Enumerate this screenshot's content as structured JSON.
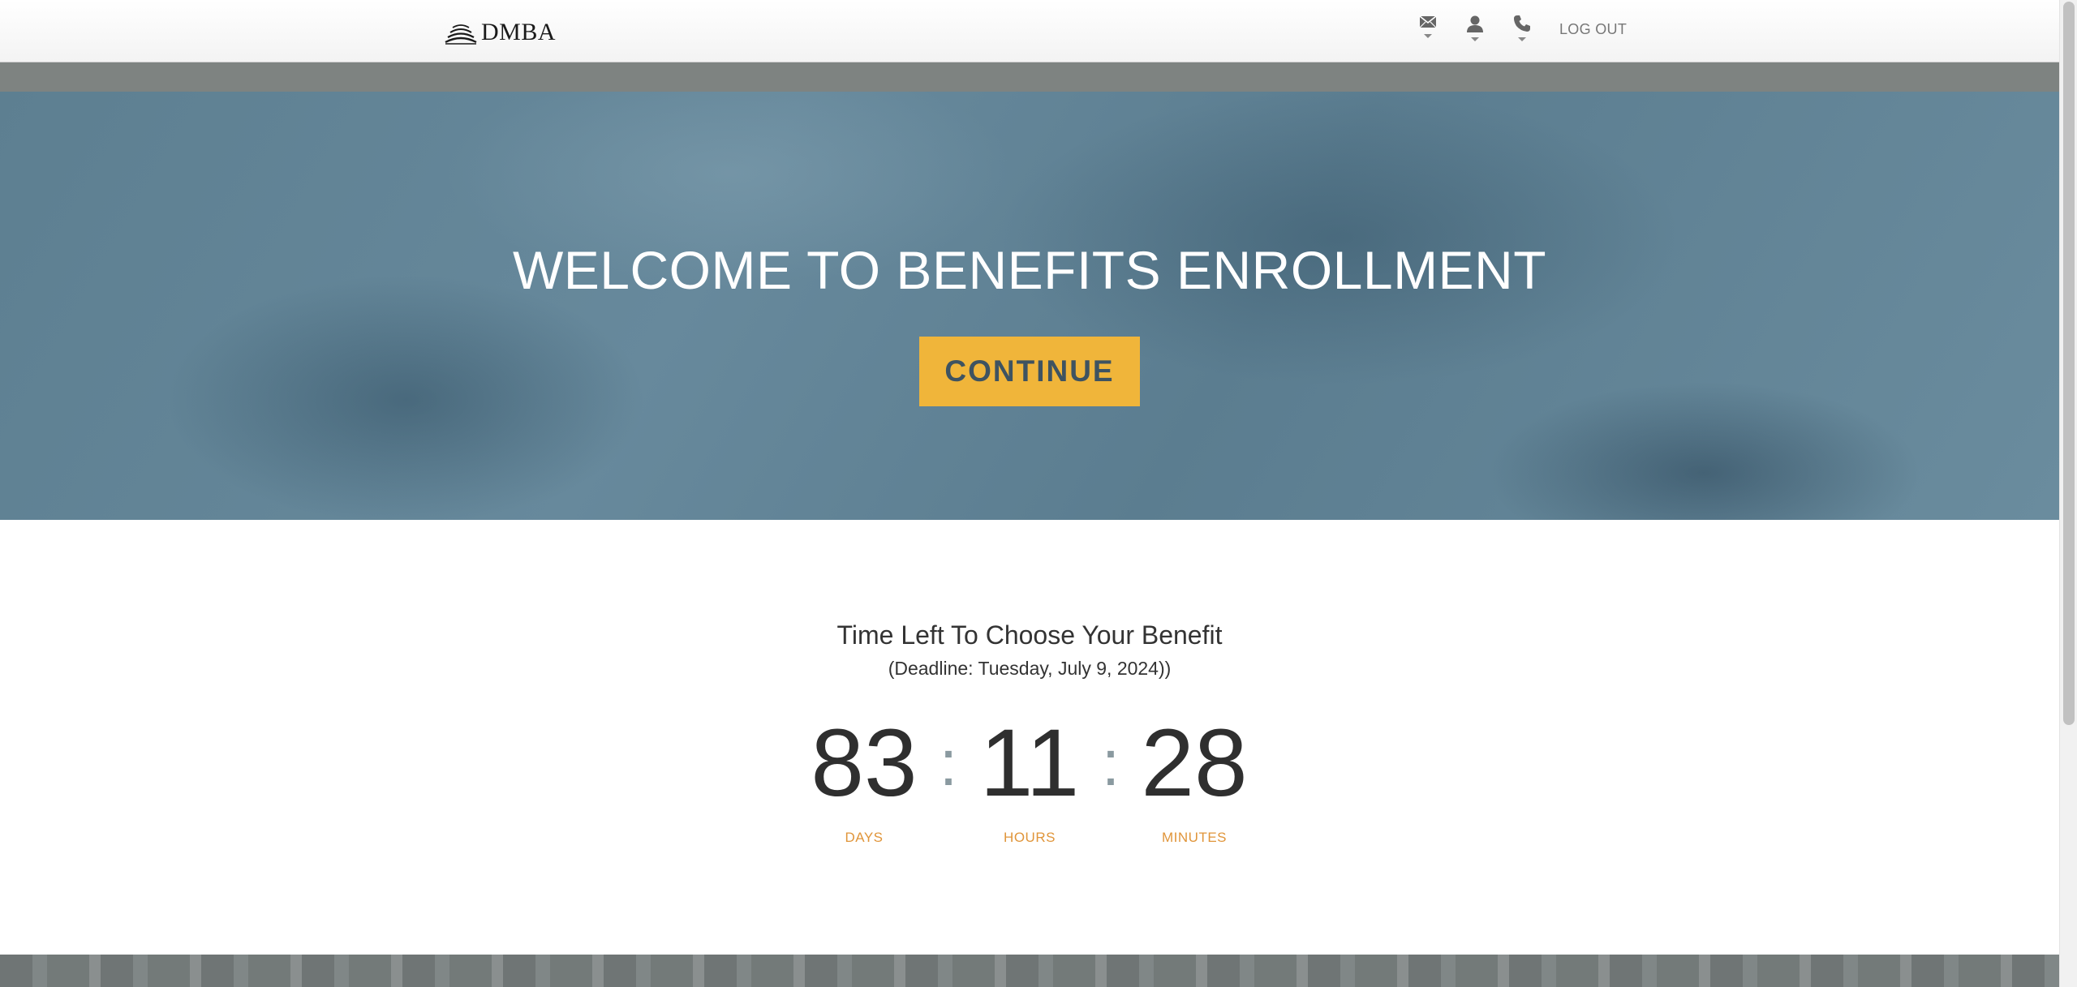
{
  "header": {
    "logo_text": "DMBA",
    "icons": [
      {
        "name": "mail-icon"
      },
      {
        "name": "user-icon"
      },
      {
        "name": "phone-icon"
      }
    ],
    "logout_label": "LOG OUT"
  },
  "hero": {
    "title": "WELCOME TO BENEFITS ENROLLMENT",
    "continue_label": "CONTINUE"
  },
  "countdown": {
    "title": "Time Left To Choose Your Benefit",
    "deadline": "(Deadline: Tuesday, July 9, 2024))",
    "days": "83",
    "hours": "11",
    "minutes": "28",
    "separator": ":",
    "days_label": "DAYS",
    "hours_label": "HOURS",
    "minutes_label": "MINUTES"
  },
  "colors": {
    "accent": "#f0b53a",
    "label_orange": "#e0953a",
    "hero_blue": "#62849a"
  }
}
